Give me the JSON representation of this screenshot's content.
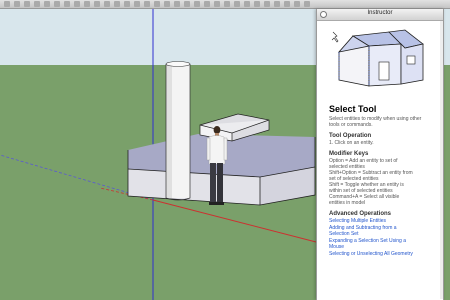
{
  "window": {
    "title": "Instructor"
  },
  "instructor": {
    "tool_title": "Select Tool",
    "description": "Select entities to modify when using other tools or commands.",
    "tool_operation": {
      "heading": "Tool Operation",
      "steps": [
        "1.  Click on an entity."
      ]
    },
    "modifier_keys": {
      "heading": "Modifier Keys",
      "lines": [
        "Option = Add an entity to set of",
        "selected entities",
        "Shift+Option = Subtract an entity from",
        "set of selected entities",
        "Shift = Toggle whether an entity is",
        "within set of selected entities",
        "Command+A = Select all visible",
        "entities in model"
      ]
    },
    "advanced": {
      "heading": "Advanced Operations",
      "links": [
        "Selecting Multiple Entities",
        "Adding and Subtracting from a",
        "Selection Set",
        "Expanding a Selection Set Using a",
        "Mouse",
        "Selecting or Unselecting All Geometry"
      ]
    }
  },
  "colors": {
    "sky": "#d8e6ec",
    "ground": "#7aa06a",
    "box_top": "#a7a9c6",
    "box_side": "#e2e2e8",
    "axis_blue": "#3030d0",
    "axis_red": "#cc3030",
    "link": "#2255cc"
  },
  "icons": [
    "close-icon",
    "house-illustration"
  ]
}
